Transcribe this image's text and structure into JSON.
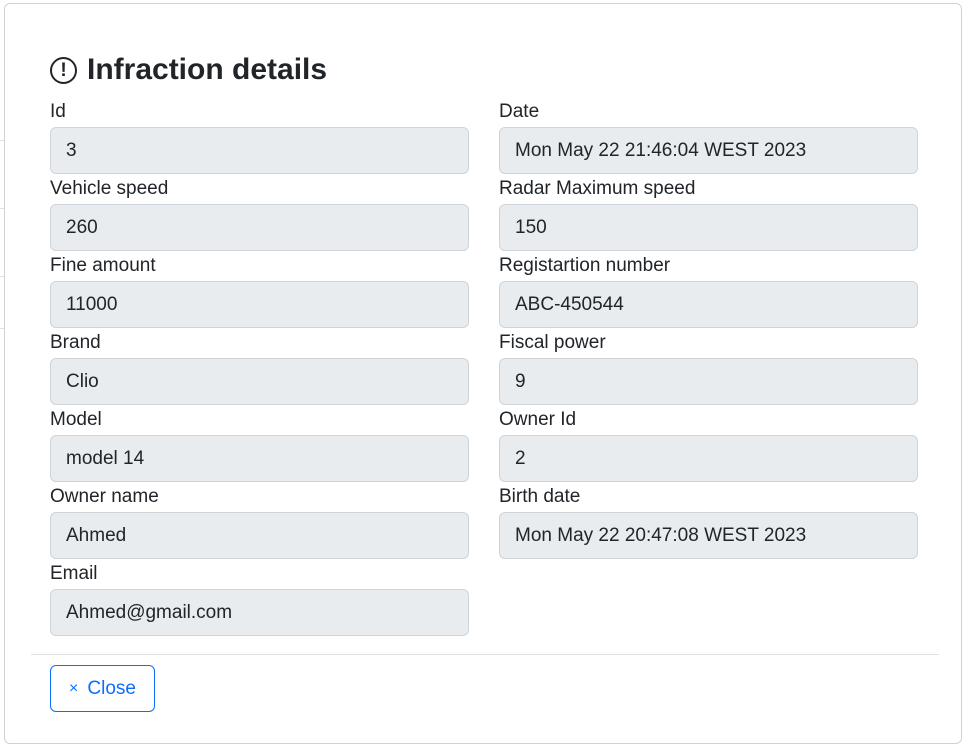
{
  "modal": {
    "title": "Infraction details",
    "title_icon": "exclamation-circle-icon",
    "fields": [
      {
        "label": "Id",
        "value": "3"
      },
      {
        "label": "Date",
        "value": "Mon May 22 21:46:04 WEST 2023"
      },
      {
        "label": "Vehicle speed",
        "value": "260"
      },
      {
        "label": "Radar Maximum speed",
        "value": "150"
      },
      {
        "label": "Fine amount",
        "value": "11000"
      },
      {
        "label": "Registartion number",
        "value": "ABC-450544"
      },
      {
        "label": "Brand",
        "value": "Clio"
      },
      {
        "label": "Fiscal power",
        "value": "9"
      },
      {
        "label": "Model",
        "value": "model 14"
      },
      {
        "label": "Owner Id",
        "value": "2"
      },
      {
        "label": "Owner name",
        "value": "Ahmed"
      },
      {
        "label": "Birth date",
        "value": "Mon May 22 20:47:08 WEST 2023"
      },
      {
        "label": "Email",
        "value": "Ahmed@gmail.com"
      }
    ],
    "close_icon": "×",
    "close_label": "Close"
  },
  "colors": {
    "accent": "#0d6efd",
    "input_bg": "#e9ecef",
    "border": "#ced4da",
    "text": "#212529"
  }
}
